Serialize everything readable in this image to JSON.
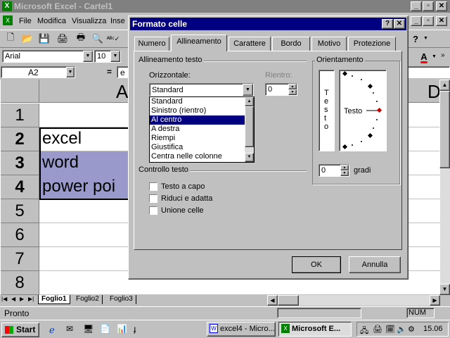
{
  "excel": {
    "title": "Microsoft Excel - Cartel1",
    "menu": [
      "File",
      "Modifica",
      "Visualizza",
      "Inse"
    ],
    "font_name": "Arial",
    "font_size": "10",
    "cell_ref": "A2",
    "formula_prefix": "=",
    "formula_value": "e",
    "col_headers": [
      "A",
      "D"
    ],
    "row_headers": [
      "1",
      "2",
      "3",
      "4",
      "5",
      "6",
      "7",
      "8"
    ],
    "cells": [
      "excel",
      "word",
      "power poi"
    ],
    "sheet_tabs": [
      "Foglio1",
      "Foglio2",
      "Foglio3"
    ],
    "status_left": "Pronto",
    "status_num": "NUM"
  },
  "dialog": {
    "title": "Formato celle",
    "help_btn": "?",
    "close_btn": "✕",
    "tabs": [
      "Numero",
      "Allineamento",
      "Carattere",
      "Bordo",
      "Motivo",
      "Protezione"
    ],
    "active_tab": "Allineamento",
    "group_alignment": "Allineamento testo",
    "label_horizontal": "Orizzontale:",
    "horizontal_value": "Standard",
    "label_indent": "Rientro:",
    "indent_value": "0",
    "horizontal_options": [
      "Standard",
      "Sinistro (rientro)",
      "Al centro",
      "A destra",
      "Riempi",
      "Giustifica",
      "Centra nelle colonne"
    ],
    "selected_option": "Al centro",
    "group_orientation": "Orientamento",
    "vertical_text": [
      "T",
      "e",
      "s",
      "t",
      "o"
    ],
    "orientation_text": "Testo",
    "degrees_value": "0",
    "degrees_label": "gradi",
    "group_control": "Controllo testo",
    "check_wrap": "Testo a capo",
    "check_shrink": "Riduci e adatta",
    "check_merge": "Unione celle",
    "ok": "OK",
    "cancel": "Annulla"
  },
  "taskbar": {
    "start": "Start",
    "task1": "excel4 - Micro...",
    "task2": "Microsoft E...",
    "clock": "15.06"
  },
  "colors": {
    "active_title": "#000080",
    "inactive_title": "#808080",
    "selection": "#000080",
    "cell_highlight": "#9999cc",
    "face": "#c0c0c0"
  }
}
